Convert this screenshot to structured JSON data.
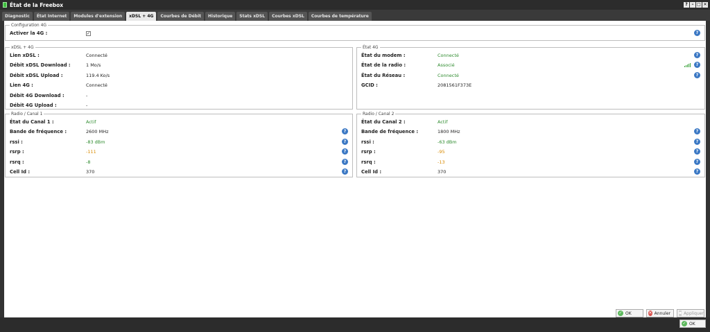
{
  "window": {
    "title": "État de la Freebox"
  },
  "tabs": [
    {
      "label": "Diagnostic"
    },
    {
      "label": "État Internet"
    },
    {
      "label": "Modules d'extension"
    },
    {
      "label": "xDSL + 4G"
    },
    {
      "label": "Courbes de Débit"
    },
    {
      "label": "Historique"
    },
    {
      "label": "Stats xDSL"
    },
    {
      "label": "Courbes xDSL"
    },
    {
      "label": "Courbes de température"
    }
  ],
  "active_tab": "xDSL + 4G",
  "config4g": {
    "legend": "Configuration 4G",
    "label": "Activer la 4G :",
    "checked_mark": "✓"
  },
  "xdsl4g": {
    "legend": "xDSL + 4G",
    "rows": [
      {
        "label": "Lien xDSL :",
        "value": "Connecté"
      },
      {
        "label": "Débit xDSL Download :",
        "value": "1 Mo/s"
      },
      {
        "label": "Débit xDSL Upload :",
        "value": "119.4 Ko/s"
      },
      {
        "label": "Lien 4G :",
        "value": "Connecté"
      },
      {
        "label": "Débit 4G Download :",
        "value": "-"
      },
      {
        "label": "Débit 4G Upload :",
        "value": "-"
      }
    ]
  },
  "etat4g": {
    "legend": "État 4G",
    "rows": [
      {
        "label": "État du modem :",
        "value": "Connecté"
      },
      {
        "label": "État de la radio :",
        "value": "Associé"
      },
      {
        "label": "État du Réseau :",
        "value": "Connecté"
      },
      {
        "label": "GCID :",
        "value": "2081561F373E"
      }
    ]
  },
  "canal1": {
    "legend": "Radio / Canal 1",
    "rows": [
      {
        "label": "État du Canal 1 :",
        "value": "Actif"
      },
      {
        "label": "Bande de fréquence :",
        "value": "2600 MHz"
      },
      {
        "label": "rssi :",
        "value": "-83 dBm"
      },
      {
        "label": "rsrp :",
        "value": "-111"
      },
      {
        "label": "rsrq :",
        "value": "-8"
      },
      {
        "label": "Cell Id :",
        "value": "370"
      }
    ]
  },
  "canal2": {
    "legend": "Radio / Canal 2",
    "rows": [
      {
        "label": "État du Canal 2 :",
        "value": "Actif"
      },
      {
        "label": "Bande de fréquence :",
        "value": "1800 MHz"
      },
      {
        "label": "rssi :",
        "value": "-63 dBm"
      },
      {
        "label": "rsrp :",
        "value": "-95"
      },
      {
        "label": "rsrq :",
        "value": "-13"
      },
      {
        "label": "Cell Id :",
        "value": "370"
      }
    ]
  },
  "buttons": {
    "ok": "OK",
    "cancel": "Annuler",
    "apply": "Appliquer",
    "bottom_ok": "OK"
  },
  "help_glyph": "?",
  "colors": {
    "good": "#2e8b2e",
    "warn": "#d98a00",
    "help": "#3b78c4"
  }
}
